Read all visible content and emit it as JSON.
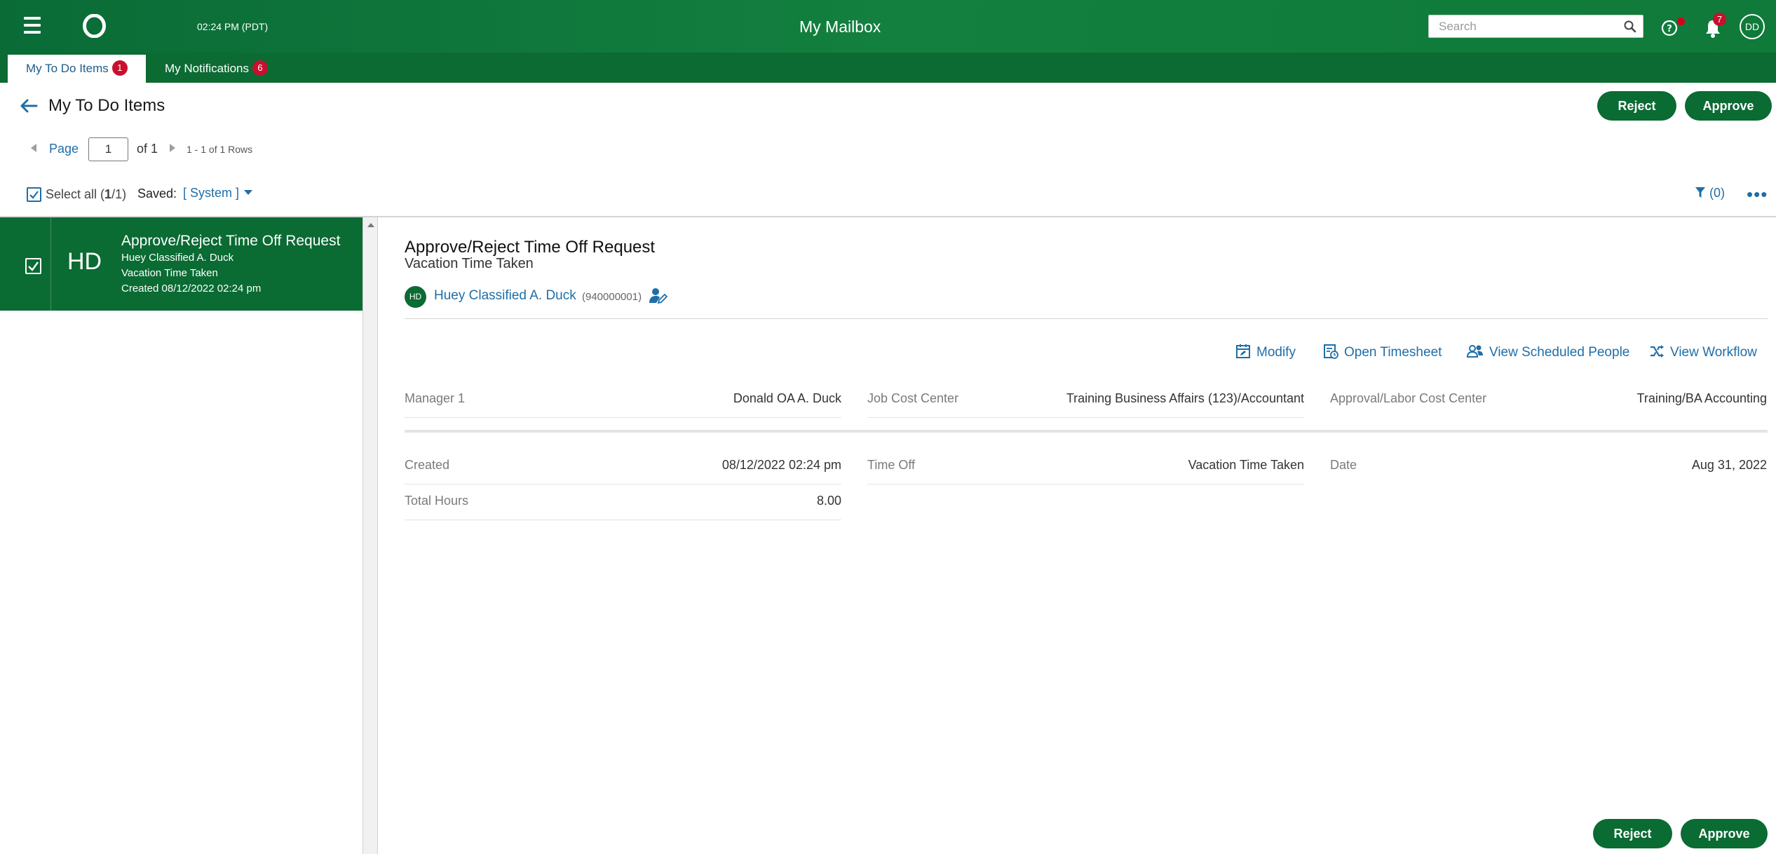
{
  "header": {
    "time": "02:24 PM (PDT)",
    "title": "My Mailbox",
    "search_placeholder": "Search",
    "notifications_count": "7",
    "user_initials": "DD"
  },
  "tabs": [
    {
      "label": "My To Do Items",
      "count": "1"
    },
    {
      "label": "My Notifications",
      "count": "6"
    }
  ],
  "page": {
    "title": "My To Do Items",
    "reject_label": "Reject",
    "approve_label": "Approve"
  },
  "pager": {
    "label": "Page",
    "current": "1",
    "of_text": "of 1",
    "rows_text": "1 - 1 of 1 Rows"
  },
  "toolbar": {
    "select_all_prefix": "Select all (",
    "select_all_bold": "1",
    "select_all_suffix": "/1)",
    "saved_label": "Saved:",
    "saved_value": "[ System ]",
    "filter_text": "(0)",
    "more_label": "•••"
  },
  "list": [
    {
      "initials": "HD",
      "title": "Approve/Reject Time Off Request",
      "name": "Huey Classified A. Duck",
      "type": "Vacation Time Taken",
      "created": "Created 08/12/2022 02:24 pm"
    }
  ],
  "detail": {
    "title": "Approve/Reject Time Off Request",
    "subtitle": "Vacation Time Taken",
    "avatar_initials": "HD",
    "person_name": "Huey Classified A. Duck",
    "person_id": "(940000001)",
    "actions": {
      "modify": "Modify",
      "open_timesheet": "Open Timesheet",
      "view_scheduled": "View Scheduled People",
      "view_workflow": "View Workflow"
    },
    "fields_1": [
      {
        "label": "Manager 1",
        "value": "Donald OA A. Duck"
      },
      {
        "label": "Job Cost Center",
        "value": "Training Business Affairs (123)/Accountant"
      },
      {
        "label": "Approval/Labor Cost Center",
        "value": "Training/BA Accounting"
      }
    ],
    "fields_2": [
      {
        "label": "Created",
        "value": "08/12/2022 02:24 pm"
      },
      {
        "label": "Time Off",
        "value": "Vacation Time Taken"
      },
      {
        "label": "Date",
        "value": "Aug 31, 2022"
      },
      {
        "label": "Total Hours",
        "value": "8.00"
      }
    ]
  },
  "colors": {
    "brand_green": "#0a6b33",
    "link_blue": "#1f6ea8",
    "badge_red": "#c8102e"
  },
  "icons": [
    "menu-icon",
    "logo-icon",
    "search-icon",
    "help-icon",
    "bell-icon",
    "back-arrow-icon",
    "checkbox-icon",
    "filter-icon",
    "more-icon",
    "person-edit-icon",
    "calendar-edit-icon",
    "timesheet-icon",
    "people-icon",
    "workflow-icon"
  ]
}
